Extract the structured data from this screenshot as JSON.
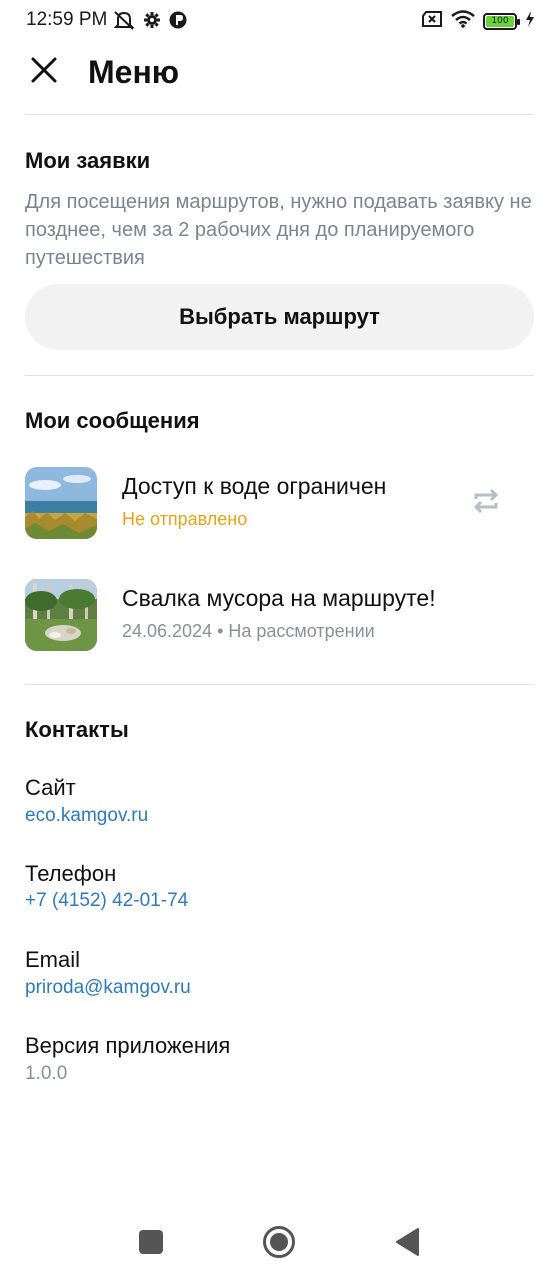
{
  "status_bar": {
    "time": "12:59 PM",
    "battery_level": "100",
    "icons": [
      "mute-icon",
      "settings-icon",
      "app-icon",
      "sim-x-icon",
      "wifi-icon",
      "battery-icon",
      "charging-icon"
    ]
  },
  "header": {
    "title": "Меню",
    "close_icon": "close-icon"
  },
  "requests": {
    "title": "Мои заявки",
    "hint": "Для посещения маршрутов, нужно подавать заявку не позднее, чем за 2 рабочих дня до планируемого путешествия",
    "button_label": "Выбрать маршрут"
  },
  "messages": {
    "title": "Мои сообщения",
    "items": [
      {
        "title": "Доступ к воде ограничен",
        "subtitle": "Не отправлено",
        "status": "pending",
        "retry_icon": "retry-icon"
      },
      {
        "title": "Свалка мусора на маршруте!",
        "subtitle": "24.06.2024 • На рассмотрении",
        "status": "review"
      }
    ]
  },
  "contacts": {
    "title": "Контакты",
    "items": [
      {
        "label": "Сайт",
        "value": "eco.kamgov.ru"
      },
      {
        "label": "Телефон",
        "value": "+7 (4152) 42-01-74"
      },
      {
        "label": "Email",
        "value": "priroda@kamgov.ru"
      },
      {
        "label": "Версия приложения",
        "value": "1.0.0"
      }
    ]
  },
  "colors": {
    "accent_link": "#2f7ab8",
    "pending": "#e8a317",
    "muted": "#8a9098",
    "button_bg": "#f2f2f2"
  },
  "nav_bar": {
    "icons": [
      "recents-icon",
      "home-icon",
      "back-icon"
    ]
  }
}
